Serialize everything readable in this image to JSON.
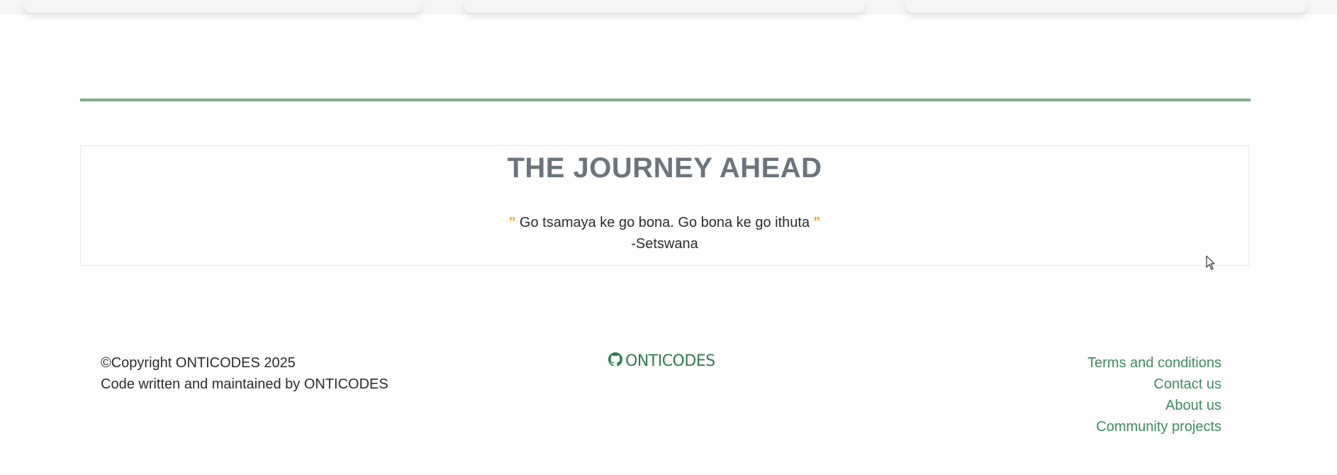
{
  "journey": {
    "title": "THE JOURNEY AHEAD",
    "quote_open": "\"",
    "quote_text": " Go tsamaya ke go bona. Go bona ke go ithuta ",
    "quote_close": "\"",
    "source": "-Setswana"
  },
  "footer": {
    "copyright": "©Copyright ONTICODES 2025",
    "maintained_by": "Code written and maintained by ONTICODES",
    "brand": "ONTICODES",
    "brand_icon": "github-icon",
    "links": [
      {
        "label": "Terms and conditions"
      },
      {
        "label": "Contact us"
      },
      {
        "label": "About us"
      },
      {
        "label": "Community projects"
      }
    ]
  },
  "colors": {
    "divider": "#7fa98a",
    "title": "#6c757d",
    "quote_mark": "#f5a623",
    "brand": "#2e7d52",
    "link": "#3d8a5e"
  }
}
